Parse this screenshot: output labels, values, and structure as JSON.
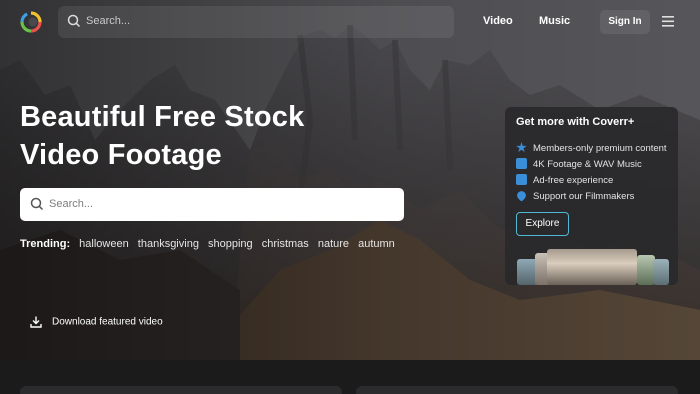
{
  "nav": {
    "search_placeholder": "Search...",
    "video_link": "Video",
    "music_link": "Music",
    "signin_label": "Sign In"
  },
  "hero": {
    "headline_line1": "Beautiful Free Stock",
    "headline_line2": "Video Footage",
    "search_placeholder": "Search...",
    "trending_label": "Trending:",
    "trending_tags": [
      "halloween",
      "thanksgiving",
      "shopping",
      "christmas",
      "nature",
      "autumn"
    ],
    "download_label": "Download featured video"
  },
  "promo": {
    "title": "Get more with Coverr+",
    "features": [
      {
        "text": "Members-only premium content",
        "icon": "star-icon"
      },
      {
        "text": "4K Footage & WAV Music",
        "icon": "4k-icon"
      },
      {
        "text": "Ad-free experience",
        "icon": "no-ads-icon"
      },
      {
        "text": "Support our Filmmakers",
        "icon": "heart-icon"
      }
    ],
    "explore_label": "Explore"
  },
  "colors": {
    "accent": "#4fb9d6",
    "feature_icon": "#3b8fd8"
  }
}
